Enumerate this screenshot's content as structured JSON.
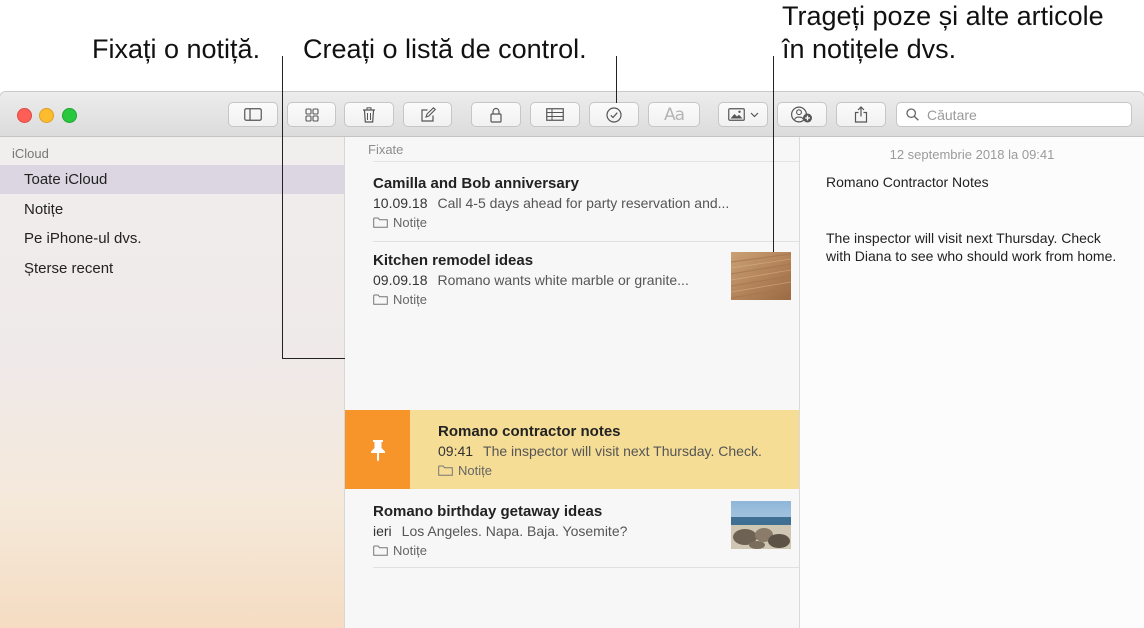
{
  "callouts": {
    "pin": "Fixați o notiță.",
    "checklist": "Creați o listă de control.",
    "drag_line1": "Trageți poze și alte articole",
    "drag_line2": "în notițele dvs."
  },
  "toolbar": {
    "format_label": "Aa",
    "search_placeholder": "Căutare"
  },
  "sidebar": {
    "section": "iCloud",
    "items": [
      {
        "label": "Toate iCloud",
        "selected": true
      },
      {
        "label": "Notițe"
      },
      {
        "label": "Pe iPhone-ul dvs."
      },
      {
        "label": "Șterse recent"
      }
    ]
  },
  "list": {
    "header": "Fixate",
    "notes": [
      {
        "title": "Camilla and Bob anniversary",
        "date": "10.09.18",
        "preview": "Call 4-5 days ahead for party reservation and...",
        "folder": "Notițe"
      },
      {
        "title": "Kitchen remodel ideas",
        "date": "09.09.18",
        "preview": "Romano wants white marble or granite...",
        "folder": "Notițe",
        "thumbnail": "wood-floor"
      },
      {
        "title": "Romano contractor notes",
        "date": "09:41",
        "preview": "The inspector will visit next Thursday. Check.",
        "folder": "Notițe",
        "selected": true
      },
      {
        "title": "Romano birthday getaway ideas",
        "date": "ieri",
        "preview": "Los Angeles. Napa. Baja. Yosemite?",
        "folder": "Notițe",
        "thumbnail": "beach-rocks"
      }
    ]
  },
  "detail": {
    "date": "12 septembrie 2018 la 09:41",
    "title": "Romano Contractor Notes",
    "body": "The inspector will visit next Thursday. Check with Diana to see who should work from home."
  },
  "colors": {
    "selected_note": "#f5dd96",
    "pin_accent": "#f7952a",
    "sidebar_selected": "#dbd6e1"
  }
}
